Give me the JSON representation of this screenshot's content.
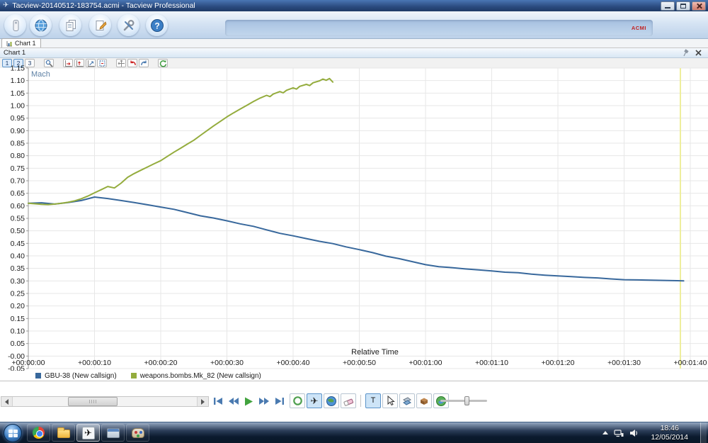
{
  "window": {
    "title": "Tacview-20140512-183754.acmi - Tacview Professional"
  },
  "glyphs": {
    "aircraft": "✈",
    "help": "?",
    "text_tool": "T"
  },
  "main_toolbar": {
    "icons": [
      "usb-drive",
      "globe",
      "documents",
      "edit-document",
      "tools",
      "help"
    ],
    "badge": "ACMI"
  },
  "doc_tab": {
    "label": "Chart 1"
  },
  "panel": {
    "title": "Chart 1"
  },
  "chart_toolbar": {
    "numbered": [
      "1",
      "2",
      "3"
    ],
    "icons": [
      "zoom-tools",
      "zoom-horizontal",
      "zoom-vertical",
      "zoom-fit",
      "zoom-window",
      "pan",
      "undo-zoom",
      "redo-zoom",
      "refresh"
    ]
  },
  "chart_data": {
    "type": "line",
    "title": "",
    "ylabel": "Mach",
    "xlabel": "Relative Time",
    "grid": true,
    "legend_position": "bottom",
    "ylim": [
      -0.05,
      1.15
    ],
    "y_tick_step": 0.05,
    "y_tick_labels": [
      "1.15",
      "1.10",
      "1.05",
      "1.00",
      "0.95",
      "0.90",
      "0.85",
      "0.80",
      "0.75",
      "0.70",
      "0.65",
      "0.60",
      "0.55",
      "0.50",
      "0.45",
      "0.40",
      "0.35",
      "0.30",
      "0.25",
      "0.20",
      "0.15",
      "0.10",
      "0.05",
      "-0.00",
      "-0.05"
    ],
    "x_range_seconds": [
      0,
      100
    ],
    "x_ticks": [
      {
        "seconds": 0,
        "label": "+00:00:00"
      },
      {
        "seconds": 10,
        "label": "+00:00:10"
      },
      {
        "seconds": 20,
        "label": "+00:00:20"
      },
      {
        "seconds": 30,
        "label": "+00:00:30"
      },
      {
        "seconds": 40,
        "label": "+00:00:40"
      },
      {
        "seconds": 50,
        "label": "+00:00:50"
      },
      {
        "seconds": 60,
        "label": "+00:01:00"
      },
      {
        "seconds": 70,
        "label": "+00:01:10"
      },
      {
        "seconds": 80,
        "label": "+00:01:20"
      },
      {
        "seconds": 90,
        "label": "+00:01:30"
      },
      {
        "seconds": 100,
        "label": "+00:01:40"
      }
    ],
    "cursor_time_seconds": 98.5,
    "cursor_color": "#eeee9c",
    "series": [
      {
        "name": "GBU-38 (New callsign)",
        "color": "#38689c",
        "points": [
          [
            0,
            0.61
          ],
          [
            2,
            0.612
          ],
          [
            4,
            0.607
          ],
          [
            6,
            0.613
          ],
          [
            8,
            0.621
          ],
          [
            10,
            0.635
          ],
          [
            12,
            0.629
          ],
          [
            14,
            0.621
          ],
          [
            16,
            0.613
          ],
          [
            18,
            0.604
          ],
          [
            20,
            0.595
          ],
          [
            22,
            0.586
          ],
          [
            24,
            0.573
          ],
          [
            26,
            0.56
          ],
          [
            28,
            0.551
          ],
          [
            30,
            0.54
          ],
          [
            32,
            0.528
          ],
          [
            34,
            0.518
          ],
          [
            36,
            0.504
          ],
          [
            38,
            0.49
          ],
          [
            40,
            0.48
          ],
          [
            42,
            0.469
          ],
          [
            44,
            0.458
          ],
          [
            46,
            0.449
          ],
          [
            48,
            0.436
          ],
          [
            50,
            0.425
          ],
          [
            52,
            0.413
          ],
          [
            54,
            0.399
          ],
          [
            56,
            0.389
          ],
          [
            58,
            0.377
          ],
          [
            60,
            0.365
          ],
          [
            62,
            0.357
          ],
          [
            64,
            0.353
          ],
          [
            66,
            0.348
          ],
          [
            68,
            0.344
          ],
          [
            70,
            0.34
          ],
          [
            72,
            0.335
          ],
          [
            74,
            0.333
          ],
          [
            76,
            0.327
          ],
          [
            78,
            0.323
          ],
          [
            80,
            0.32
          ],
          [
            82,
            0.317
          ],
          [
            84,
            0.314
          ],
          [
            86,
            0.312
          ],
          [
            88,
            0.308
          ],
          [
            90,
            0.305
          ],
          [
            92,
            0.304
          ],
          [
            94,
            0.303
          ],
          [
            96,
            0.302
          ],
          [
            98,
            0.301
          ],
          [
            99,
            0.3
          ]
        ]
      },
      {
        "name": "weapons.bombs.Mk_82 (New callsign)",
        "color": "#94ac3d",
        "points": [
          [
            0,
            0.61
          ],
          [
            1,
            0.608
          ],
          [
            2,
            0.606
          ],
          [
            3,
            0.605
          ],
          [
            4,
            0.607
          ],
          [
            5,
            0.61
          ],
          [
            6,
            0.614
          ],
          [
            7,
            0.62
          ],
          [
            8,
            0.628
          ],
          [
            9,
            0.639
          ],
          [
            10,
            0.652
          ],
          [
            11,
            0.664
          ],
          [
            12,
            0.677
          ],
          [
            13,
            0.671
          ],
          [
            14,
            0.69
          ],
          [
            15,
            0.714
          ],
          [
            16,
            0.729
          ],
          [
            17,
            0.742
          ],
          [
            18,
            0.755
          ],
          [
            19,
            0.768
          ],
          [
            20,
            0.78
          ],
          [
            21,
            0.797
          ],
          [
            22,
            0.814
          ],
          [
            23,
            0.83
          ],
          [
            24,
            0.846
          ],
          [
            25,
            0.862
          ],
          [
            26,
            0.881
          ],
          [
            27,
            0.9
          ],
          [
            28,
            0.919
          ],
          [
            29,
            0.937
          ],
          [
            30,
            0.955
          ],
          [
            31,
            0.971
          ],
          [
            32,
            0.986
          ],
          [
            33,
            1.001
          ],
          [
            34,
            1.016
          ],
          [
            35,
            1.03
          ],
          [
            36,
            1.041
          ],
          [
            36.5,
            1.036
          ],
          [
            37,
            1.046
          ],
          [
            38,
            1.056
          ],
          [
            38.5,
            1.051
          ],
          [
            39,
            1.061
          ],
          [
            40,
            1.071
          ],
          [
            40.5,
            1.066
          ],
          [
            41,
            1.077
          ],
          [
            42,
            1.085
          ],
          [
            42.5,
            1.08
          ],
          [
            43,
            1.091
          ],
          [
            44,
            1.099
          ],
          [
            44.5,
            1.106
          ],
          [
            45,
            1.101
          ],
          [
            45.5,
            1.108
          ],
          [
            46,
            1.094
          ]
        ]
      }
    ]
  },
  "playback": {
    "icons": [
      "skip-to-start",
      "rewind",
      "play",
      "fast-forward",
      "skip-to-end"
    ]
  },
  "view_toolbar": {
    "icons": [
      "record-circle",
      "aircraft-view",
      "globe-3d",
      "eraser",
      "text-tool",
      "cursor-arrow",
      "layers",
      "terrain-box",
      "planet"
    ]
  },
  "slider": {
    "value_percent": 52
  },
  "scrollbar": {
    "thumb_left_percent": 30,
    "thumb_width_percent": 27
  },
  "taskbar": {
    "time": "18:46",
    "date": "12/05/2014"
  }
}
